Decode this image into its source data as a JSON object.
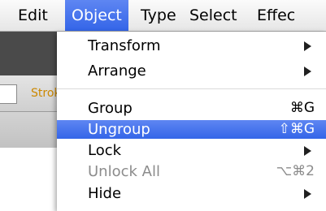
{
  "menubar": {
    "items": [
      {
        "label": "Edit"
      },
      {
        "label": "Object",
        "selected": true
      },
      {
        "label": "Type"
      },
      {
        "label": "Select"
      },
      {
        "label": "Effec"
      }
    ]
  },
  "background_app": {
    "stroke_label": "Strok"
  },
  "object_menu": {
    "items": [
      {
        "label": "Transform",
        "submenu": true
      },
      {
        "label": "Arrange",
        "submenu": true
      },
      {
        "label": "Group",
        "shortcut": "⌘G"
      },
      {
        "label": "Ungroup",
        "shortcut": "⇧⌘G",
        "highlighted": true
      },
      {
        "label": "Lock",
        "submenu": true
      },
      {
        "label": "Unlock All",
        "shortcut": "⌥⌘2",
        "disabled": true
      },
      {
        "label": "Hide",
        "submenu": true
      }
    ]
  },
  "colors": {
    "highlight": "#3a6bea",
    "stroke_label": "#cc8800",
    "disabled_text": "#8c8c8c"
  }
}
